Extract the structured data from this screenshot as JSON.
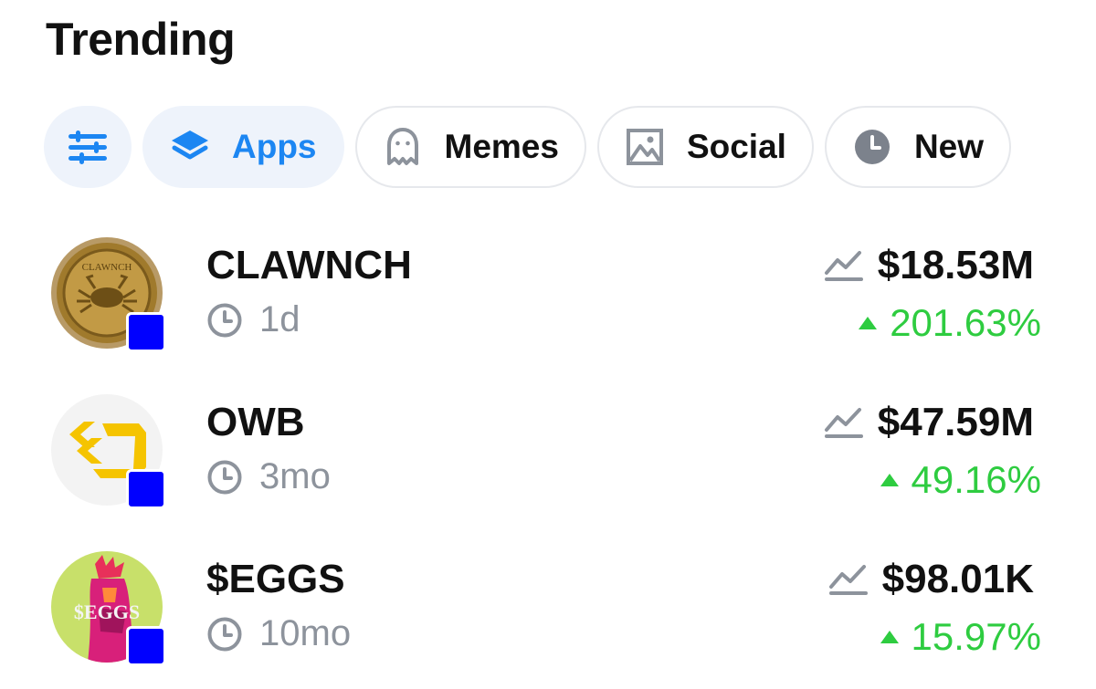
{
  "header": {
    "title": "Trending"
  },
  "filters": {
    "settings_icon": "sliders-icon",
    "chips": [
      {
        "label": "Apps",
        "icon": "layers-icon",
        "active": true
      },
      {
        "label": "Memes",
        "icon": "ghost-icon",
        "active": false
      },
      {
        "label": "Social",
        "icon": "image-icon",
        "active": false
      },
      {
        "label": "New",
        "icon": "clock-icon",
        "active": false
      }
    ]
  },
  "colors": {
    "accent": "#1c86f2",
    "positive": "#2ecc40",
    "muted": "#8d939c",
    "chip_bg": "#eef3fb",
    "chain_badge": "#0000ff"
  },
  "tokens": [
    {
      "name": "CLAWNCH",
      "age": "1d",
      "market_cap": "$18.53M",
      "change": "201.63%",
      "avatar_text": "CLAWNCH",
      "avatar_icon": "gold-crab-coin"
    },
    {
      "name": "OWB",
      "age": "3mo",
      "market_cap": "$47.59M",
      "change": "49.16%",
      "avatar_icon": "yellow-chevron-logo"
    },
    {
      "name": "$EGGS",
      "age": "10mo",
      "market_cap": "$98.01K",
      "change": "15.97%",
      "avatar_text": "$EGGS",
      "avatar_icon": "pink-rooster"
    }
  ]
}
